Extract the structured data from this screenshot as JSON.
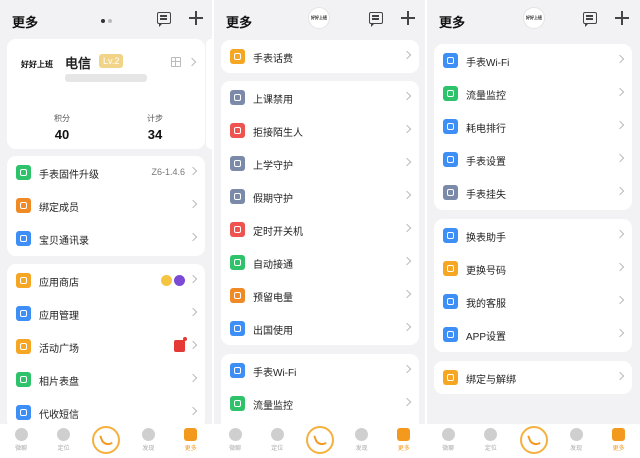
{
  "header": {
    "title": "更多"
  },
  "brand": {
    "text": "好好上班"
  },
  "profile": {
    "carrier": "电信",
    "level": "Lv.2",
    "stats": [
      {
        "label": "积分",
        "value": "40"
      },
      {
        "label": "计步",
        "value": "34"
      }
    ]
  },
  "panel1": {
    "group1": [
      {
        "label": "手表固件升级",
        "value": "Z6-1.4.6",
        "icon": "upload-icon",
        "color": "#2ec26a"
      },
      {
        "label": "绑定成员",
        "icon": "members-icon",
        "color": "#f08a24"
      },
      {
        "label": "宝贝通讯录",
        "icon": "contacts-icon",
        "color": "#3d8ff5"
      }
    ],
    "group2": [
      {
        "label": "应用商店",
        "icon": "store-icon",
        "color": "#f5a623"
      },
      {
        "label": "应用管理",
        "icon": "app-manage-icon",
        "color": "#3d8ff5"
      },
      {
        "label": "活动广场",
        "icon": "gift-icon",
        "color": "#f5a623"
      },
      {
        "label": "相片表盘",
        "icon": "photo-icon",
        "color": "#2ec26a"
      },
      {
        "label": "代收短信",
        "icon": "sms-icon",
        "color": "#3d8ff5"
      }
    ]
  },
  "panel2": {
    "group0": [
      {
        "label": "手表话费",
        "icon": "bill-icon",
        "color": "#f5a623"
      }
    ],
    "group1": [
      {
        "label": "上课禁用",
        "icon": "class-ban-icon",
        "color": "#7a8aa8"
      },
      {
        "label": "拒接陌生人",
        "icon": "block-icon",
        "color": "#ef5350"
      },
      {
        "label": "上学守护",
        "icon": "school-icon",
        "color": "#7a8aa8"
      },
      {
        "label": "假期守护",
        "icon": "home-icon",
        "color": "#7a8aa8"
      },
      {
        "label": "定时开关机",
        "icon": "power-icon",
        "color": "#ef5350"
      },
      {
        "label": "自动接通",
        "icon": "phone-icon",
        "color": "#2ec26a"
      },
      {
        "label": "预留电量",
        "icon": "battery-icon",
        "color": "#f08a24"
      },
      {
        "label": "出国使用",
        "icon": "plane-icon",
        "color": "#3d8ff5"
      }
    ],
    "group2": [
      {
        "label": "手表Wi-Fi",
        "icon": "wifi-icon",
        "color": "#3d8ff5"
      },
      {
        "label": "流量监控",
        "icon": "traffic-icon",
        "color": "#2ec26a"
      }
    ]
  },
  "panel3": {
    "group1": [
      {
        "label": "手表Wi-Fi",
        "icon": "wifi-icon",
        "color": "#3d8ff5"
      },
      {
        "label": "流量监控",
        "icon": "traffic-icon",
        "color": "#2ec26a"
      },
      {
        "label": "耗电排行",
        "icon": "power-rank-icon",
        "color": "#3d8ff5"
      },
      {
        "label": "手表设置",
        "icon": "settings-icon",
        "color": "#3d8ff5"
      },
      {
        "label": "手表挂失",
        "icon": "lost-icon",
        "color": "#7a8aa8"
      }
    ],
    "group2": [
      {
        "label": "换表助手",
        "icon": "swap-icon",
        "color": "#3d8ff5"
      },
      {
        "label": "更换号码",
        "icon": "number-icon",
        "color": "#f5a623"
      },
      {
        "label": "我的客服",
        "icon": "service-icon",
        "color": "#3d8ff5"
      },
      {
        "label": "APP设置",
        "icon": "app-settings-icon",
        "color": "#3d8ff5"
      }
    ],
    "group3": [
      {
        "label": "绑定与解绑",
        "icon": "bind-icon",
        "color": "#f5a623"
      }
    ]
  },
  "tabs": [
    "微聊",
    "定位",
    "",
    "发现",
    "更多"
  ]
}
